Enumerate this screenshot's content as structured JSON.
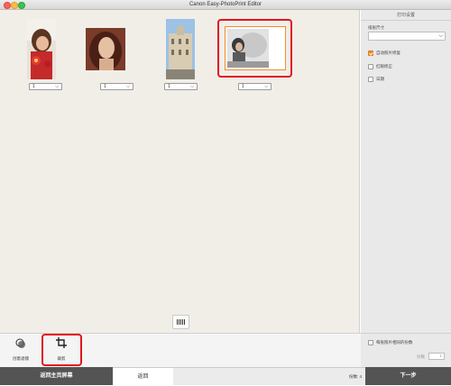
{
  "window": {
    "title": "Canon Easy-PhotoPrint Editor"
  },
  "photos": [
    {
      "name": "girl-with-flower",
      "quantity": "1"
    },
    {
      "name": "woman-portrait",
      "quantity": "1"
    },
    {
      "name": "street-building",
      "quantity": "1"
    },
    {
      "name": "child-photo",
      "quantity": "1",
      "selected": true
    }
  ],
  "sidebar": {
    "header": "打印设置",
    "paper_size_label": "纸张尺寸",
    "paper_size_value": "",
    "options": [
      {
        "label": "自动照片修复",
        "checked": true
      },
      {
        "label": "红眼修正",
        "checked": false
      },
      {
        "label": "日期",
        "checked": false
      }
    ],
    "same_copies_label": "每张照片相同的份数",
    "copies_label": "份数",
    "copies_value": "1"
  },
  "toolbar": {
    "filter_label": "创意滤镜",
    "crop_label": "裁剪"
  },
  "bottom": {
    "home_label": "返回主页屏幕",
    "back_label": "返回",
    "print_count": "份数: 4",
    "next_label": "下一步"
  },
  "colors": {
    "accent": "#f08b2c",
    "highlight": "#e0161e",
    "dark_button": "#545454"
  }
}
